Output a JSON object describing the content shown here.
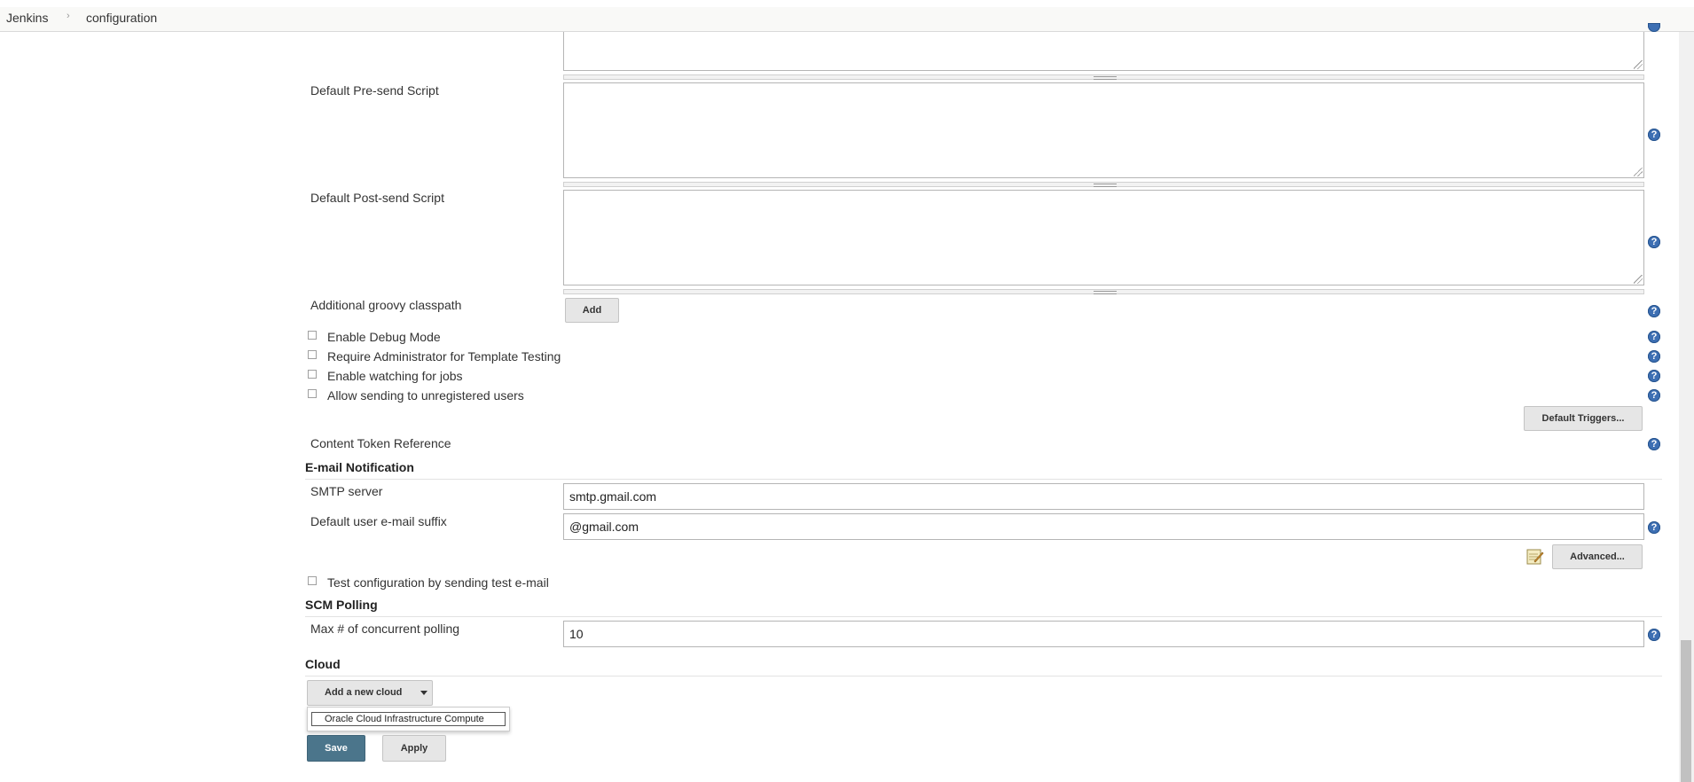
{
  "breadcrumb": {
    "home": "Jenkins",
    "separator": "›",
    "current": "configuration"
  },
  "extended_email": {
    "pre_send_label": "Default Pre-send Script",
    "post_send_label": "Default Post-send Script",
    "groovy_classpath_label": "Additional groovy classpath",
    "add_label": "Add",
    "checkboxes": [
      {
        "label": "Enable Debug Mode",
        "checked": false
      },
      {
        "label": "Require Administrator for Template Testing",
        "checked": false
      },
      {
        "label": "Enable watching for jobs",
        "checked": false
      },
      {
        "label": "Allow sending to unregistered users",
        "checked": false
      }
    ],
    "default_triggers_label": "Default Triggers...",
    "content_token_label": "Content Token Reference"
  },
  "email_notification": {
    "title": "E-mail Notification",
    "smtp_label": "SMTP server",
    "smtp_value": "smtp.gmail.com",
    "suffix_label": "Default user e-mail suffix",
    "suffix_value": "@gmail.com",
    "advanced_label": "Advanced...",
    "test_label": "Test configuration by sending test e-mail"
  },
  "scm_polling": {
    "title": "SCM Polling",
    "max_label": "Max # of concurrent polling",
    "max_value": "10"
  },
  "cloud": {
    "title": "Cloud",
    "add_cloud_label": "Add a new cloud",
    "dropdown_options": [
      "Oracle Cloud Infrastructure Compute"
    ]
  },
  "actions": {
    "save_label": "Save",
    "apply_label": "Apply"
  },
  "help_glyph": "?",
  "colors": {
    "save_bg": "#4b758b",
    "help_icon": "#3d6fb3"
  }
}
